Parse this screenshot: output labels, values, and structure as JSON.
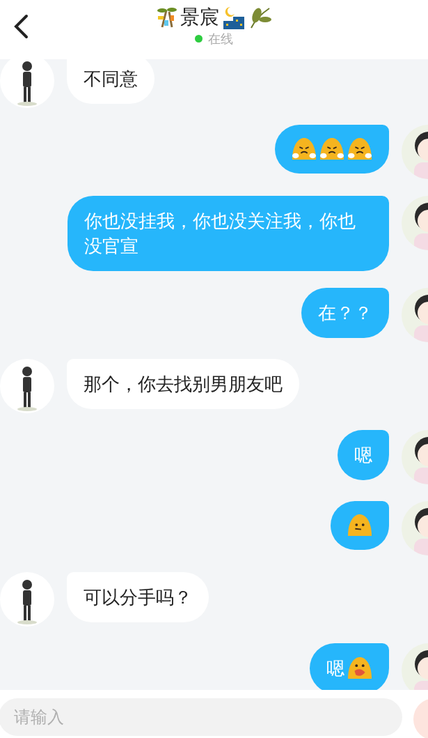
{
  "header": {
    "title": "景宸",
    "status": "在线",
    "online": true
  },
  "messages": [
    {
      "outgoing": false,
      "parts": [
        {
          "kind": "text",
          "text": "不同意"
        }
      ]
    },
    {
      "outgoing": true,
      "parts": [
        {
          "kind": "angry"
        },
        {
          "kind": "angry"
        },
        {
          "kind": "angry"
        }
      ]
    },
    {
      "outgoing": true,
      "parts": [
        {
          "kind": "text",
          "text": "你也没挂我，你也没关注我，你也没官宣"
        }
      ]
    },
    {
      "outgoing": true,
      "parts": [
        {
          "kind": "text",
          "text": "在？？"
        }
      ]
    },
    {
      "outgoing": false,
      "parts": [
        {
          "kind": "text",
          "text": "那个，你去找别男朋友吧"
        }
      ]
    },
    {
      "outgoing": true,
      "parts": [
        {
          "kind": "text",
          "text": "嗯"
        }
      ]
    },
    {
      "outgoing": true,
      "parts": [
        {
          "kind": "flat"
        }
      ]
    },
    {
      "outgoing": false,
      "parts": [
        {
          "kind": "text",
          "text": "可以分手吗？"
        }
      ]
    },
    {
      "outgoing": true,
      "parts": [
        {
          "kind": "text",
          "text": "嗯"
        },
        {
          "kind": "scared"
        }
      ]
    }
  ],
  "input": {
    "placeholder": "请输入"
  }
}
